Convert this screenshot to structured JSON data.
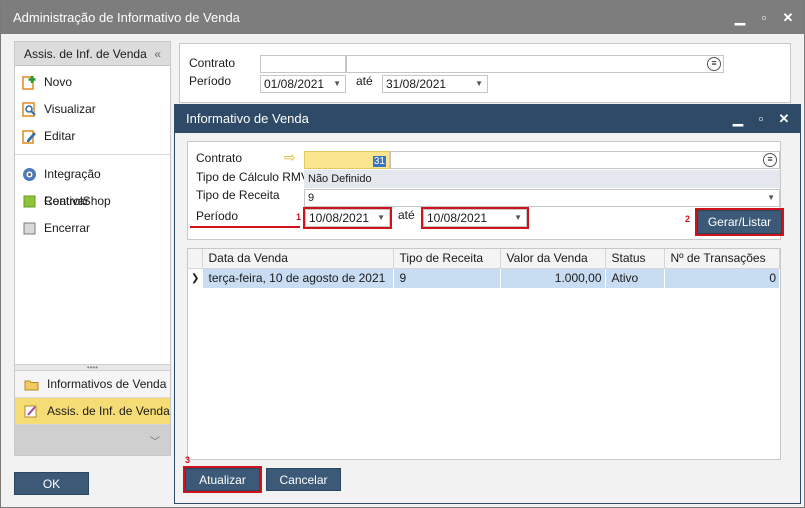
{
  "window": {
    "title": "Administração de Informativo de Venda"
  },
  "sidebar": {
    "header": "Assis. de Inf. de Venda",
    "actions": [
      {
        "label": "Novo",
        "icon": "new-document-icon"
      },
      {
        "label": "Visualizar",
        "icon": "magnifier-icon"
      },
      {
        "label": "Editar",
        "icon": "pencil-icon"
      }
    ],
    "actions2": [
      {
        "label": "Integração ControlShop",
        "icon": "integration-icon"
      },
      {
        "label": "Reativar",
        "icon": "reactivate-icon"
      },
      {
        "label": "Encerrar",
        "icon": "close-square-icon"
      }
    ],
    "nav": [
      {
        "label": "Informativos de Venda",
        "icon": "folder-icon"
      },
      {
        "label": "Assis. de Inf. de Venda",
        "icon": "wizard-icon"
      }
    ]
  },
  "bg_form": {
    "contrato_label": "Contrato",
    "periodo_label": "Período",
    "date_from": "01/08/2021",
    "ate_label": "até",
    "date_to": "31/08/2021"
  },
  "outer_buttons": {
    "ok": "OK"
  },
  "dialog": {
    "title": "Informativo de Venda",
    "form": {
      "contrato_label": "Contrato",
      "contrato_value": "31",
      "tipo_calculo_label": "Tipo de Cálculo RMV",
      "tipo_calculo_value": "Não Definido",
      "tipo_receita_label": "Tipo de Receita",
      "tipo_receita_value": "9",
      "periodo_label": "Período",
      "date_from": "10/08/2021",
      "ate_label": "até",
      "date_to": "10/08/2021",
      "gerar_label": "Gerar/Listar"
    },
    "grid": {
      "columns": [
        "Data da Venda",
        "Tipo de Receita",
        "Valor da Venda",
        "Status",
        "Nº de Transações"
      ],
      "rows": [
        [
          "terça-feira, 10 de agosto de 2021",
          "9",
          "1.000,00",
          "Ativo",
          "0"
        ]
      ]
    },
    "buttons": {
      "atualizar": "Atualizar",
      "cancelar": "Cancelar"
    },
    "markers": [
      "1",
      "2",
      "3"
    ]
  },
  "colors": {
    "accent": "#2e4a66",
    "highlight": "#d0121b",
    "selected_nav": "#f6dc74",
    "row_selected": "#c8dcf2"
  }
}
